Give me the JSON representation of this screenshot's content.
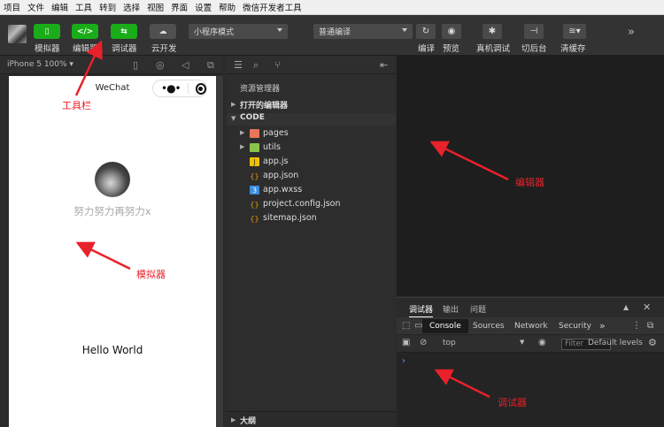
{
  "menu": [
    "项目",
    "文件",
    "编辑",
    "工具",
    "转到",
    "选择",
    "视图",
    "界面",
    "设置",
    "帮助",
    "微信开发者工具"
  ],
  "toolbar": {
    "simulator_label": "模拟器",
    "editor_label": "编辑器",
    "debugger_label": "调试器",
    "cloud_label": "云开发",
    "mode_select": "小程序模式",
    "compile_select": "普通编译",
    "compile_label": "编译",
    "preview_label": "预览",
    "realdevice_label": "真机调试",
    "background_label": "切后台",
    "clearcache_label": "清缓存",
    "more_icon": "»"
  },
  "simulator": {
    "device": "iPhone 5 100% ▾",
    "nav_title": "WeChat",
    "nickname": "努力努力再努力x",
    "hello": "Hello World"
  },
  "explorer": {
    "title": "资源管理器",
    "open_editors": "打开的编辑器",
    "project": "CODE",
    "files": [
      {
        "name": "pages",
        "icon": "folder-icon",
        "color": "#e8765a"
      },
      {
        "name": "utils",
        "icon": "folder-icon",
        "color": "#8bc34a"
      },
      {
        "name": "app.js",
        "icon": "js-file-icon",
        "color": "#f0c000"
      },
      {
        "name": "app.json",
        "icon": "json-file-icon",
        "color": "#f0a000"
      },
      {
        "name": "app.wxss",
        "icon": "css-file-icon",
        "color": "#3c8dde"
      },
      {
        "name": "project.config.json",
        "icon": "json-file-icon",
        "color": "#f0a000"
      },
      {
        "name": "sitemap.json",
        "icon": "json-file-icon",
        "color": "#f0a000"
      }
    ],
    "outline": "大纲"
  },
  "debugger": {
    "tabs": [
      "调试器",
      "输出",
      "问题"
    ],
    "panels": [
      "Console",
      "Sources",
      "Network",
      "Security"
    ],
    "more": "»",
    "context": "top",
    "filter_placeholder": "Filter",
    "levels": "Default levels",
    "prompt": "›"
  },
  "annotations": {
    "toolbar": "工具栏",
    "simulator": "模拟器",
    "editor": "编辑器",
    "debugger": "调试器"
  },
  "colors": {
    "accent_green": "#1aad19",
    "annotation_red": "#e8212a"
  }
}
